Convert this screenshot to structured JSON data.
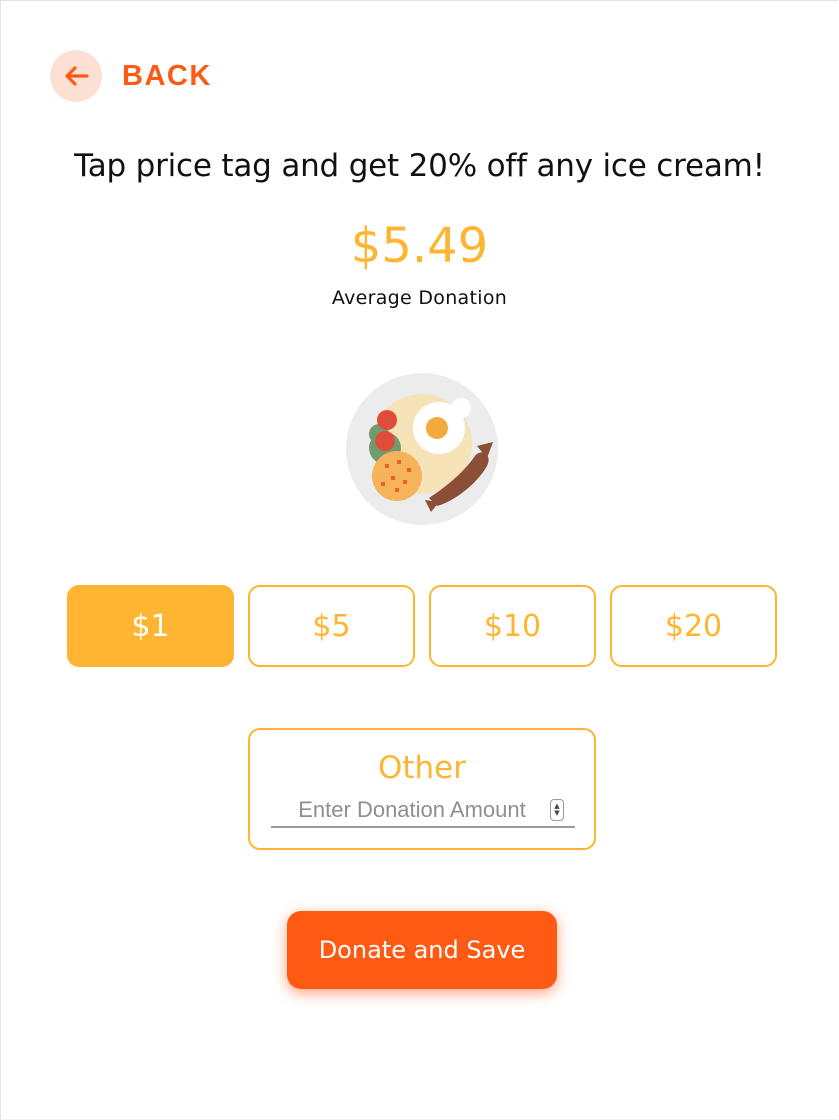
{
  "header": {
    "back_label": "BACK",
    "back_icon": "arrow-left-icon"
  },
  "promo": {
    "headline": "Tap price tag and get 20% off any ice cream!"
  },
  "average": {
    "amount": "$5.49",
    "label": "Average Donation"
  },
  "illustration": {
    "icon": "breakfast-plate-icon"
  },
  "amounts": {
    "options": [
      {
        "label": "$1",
        "selected": true
      },
      {
        "label": "$5",
        "selected": false
      },
      {
        "label": "$10",
        "selected": false
      },
      {
        "label": "$20",
        "selected": false
      }
    ]
  },
  "other": {
    "label": "Other",
    "placeholder": "Enter Donation Amount",
    "value": ""
  },
  "actions": {
    "donate_label": "Donate and Save"
  },
  "colors": {
    "accent": "#ff5a14",
    "gold": "#ffb531",
    "back_circle": "#fde0d4"
  }
}
